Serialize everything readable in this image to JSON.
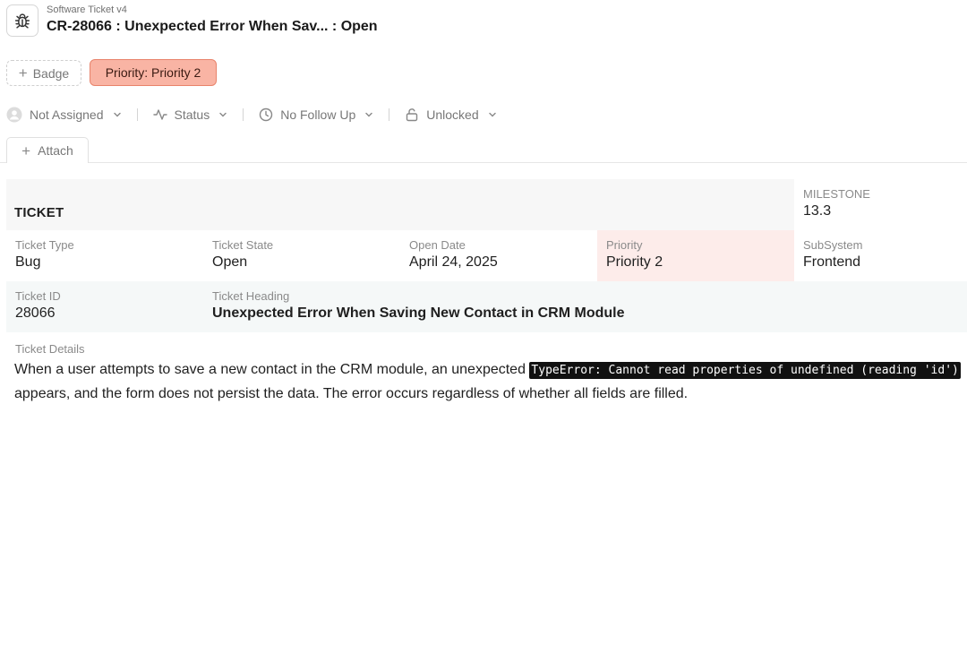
{
  "header": {
    "app_name": "Software Ticket v4",
    "title": "CR-28066 : Unexpected Error When Sav... : Open",
    "icon": "bug-icon"
  },
  "badges": {
    "add_label": "Badge",
    "priority_label": "Priority: Priority 2",
    "priority_color": "#f9b4a4"
  },
  "toolbar": {
    "assignee": "Not Assigned",
    "status": "Status",
    "follow_up": "No Follow Up",
    "lock": "Unlocked"
  },
  "attach": {
    "label": "Attach"
  },
  "section": {
    "title": "TICKET"
  },
  "fields": {
    "milestone": {
      "label": "MILESTONE",
      "value": "13.3"
    },
    "ticket_type": {
      "label": "Ticket Type",
      "value": "Bug"
    },
    "ticket_state": {
      "label": "Ticket State",
      "value": "Open"
    },
    "open_date": {
      "label": "Open Date",
      "value": "April 24, 2025"
    },
    "priority": {
      "label": "Priority",
      "value": "Priority 2"
    },
    "subsystem": {
      "label": "SubSystem",
      "value": "Frontend"
    },
    "ticket_id": {
      "label": "Ticket ID",
      "value": "28066"
    },
    "ticket_heading": {
      "label": "Ticket Heading",
      "value": "Unexpected Error When Saving New Contact in CRM Module"
    }
  },
  "details": {
    "label": "Ticket Details",
    "text_before": "When a user attempts to save a new contact in the CRM module, an unexpected ",
    "code": "TypeError: Cannot read properties of undefined (reading 'id')",
    "text_after": " appears, and the form does not persist the data. The error occurs regardless of whether all fields are filled."
  }
}
